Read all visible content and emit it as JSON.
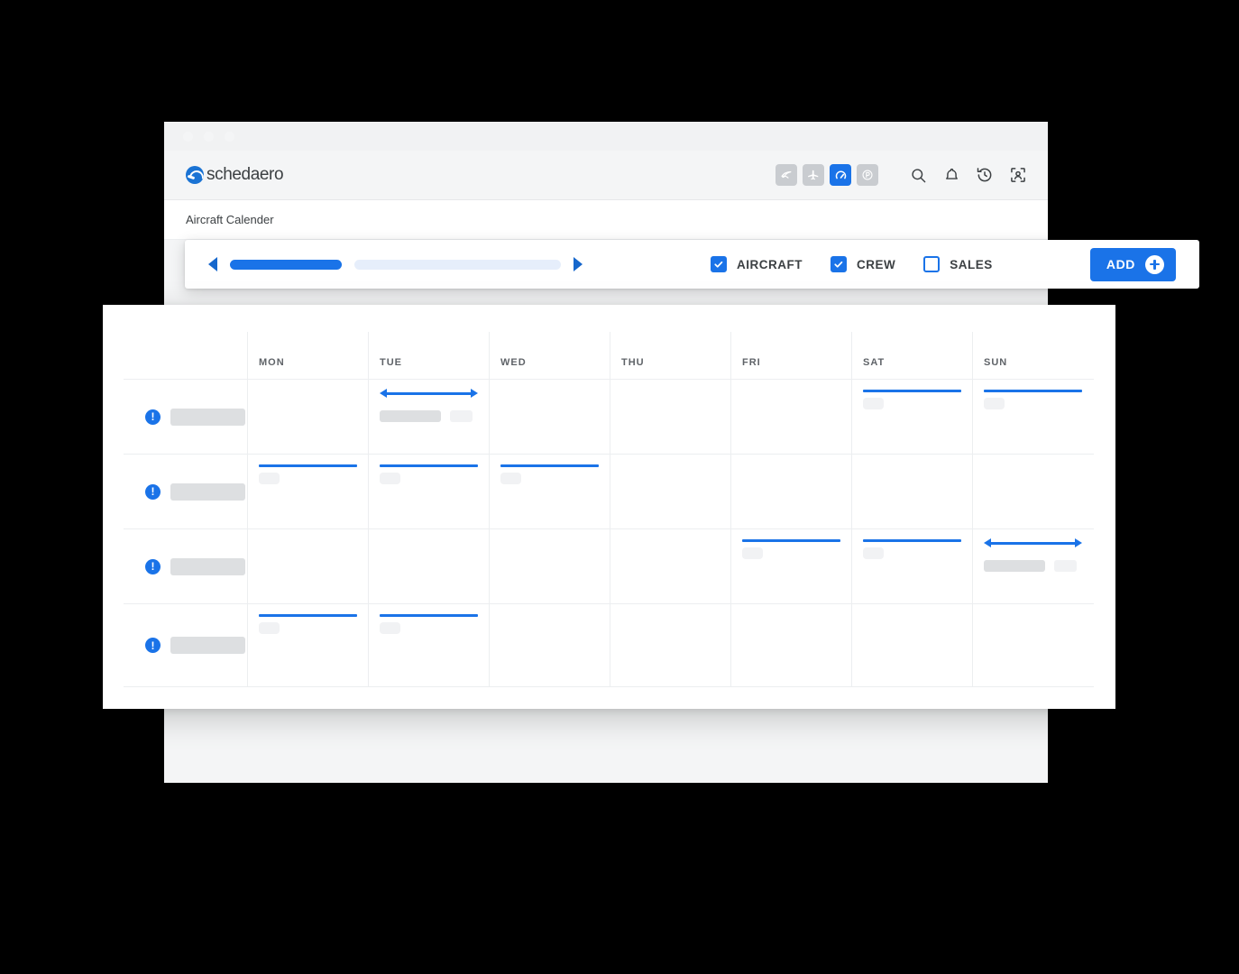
{
  "window": {
    "dots": [
      "close",
      "minimize",
      "maximize"
    ]
  },
  "header": {
    "brand": "schedaero",
    "module_icons": [
      {
        "name": "swoosh-icon",
        "active": false
      },
      {
        "name": "airplane-icon",
        "active": false
      },
      {
        "name": "gauge-icon",
        "active": true
      },
      {
        "name": "parking-icon",
        "active": false
      }
    ],
    "action_icons": [
      {
        "name": "search-icon"
      },
      {
        "name": "bell-icon"
      },
      {
        "name": "history-icon"
      },
      {
        "name": "user-frame-icon"
      }
    ]
  },
  "breadcrumb": {
    "text": "Aircraft Calender"
  },
  "toolbar": {
    "prev_label": "previous",
    "next_label": "next",
    "progress_filled_pct": 35,
    "progress_empty_pct": 65,
    "filters": [
      {
        "label": "AIRCRAFT",
        "checked": true
      },
      {
        "label": "CREW",
        "checked": true
      },
      {
        "label": "SALES",
        "checked": false
      }
    ],
    "add_label": "ADD"
  },
  "calendar": {
    "days": [
      "MON",
      "TUE",
      "WED",
      "THU",
      "FRI",
      "SAT",
      "SUN"
    ],
    "rows": [
      {
        "status": "!",
        "name_placeholder": "",
        "cells": [
          {
            "day": "MON",
            "type": "empty"
          },
          {
            "day": "TUE",
            "type": "arrow",
            "detail": true
          },
          {
            "day": "WED",
            "type": "empty"
          },
          {
            "day": "THU",
            "type": "empty"
          },
          {
            "day": "FRI",
            "type": "empty"
          },
          {
            "day": "SAT",
            "type": "line",
            "detail": false
          },
          {
            "day": "SUN",
            "type": "line",
            "detail": false
          }
        ]
      },
      {
        "status": "!",
        "name_placeholder": "",
        "cells": [
          {
            "day": "MON",
            "type": "line",
            "detail": false
          },
          {
            "day": "TUE",
            "type": "line",
            "detail": false
          },
          {
            "day": "WED",
            "type": "line",
            "detail": false
          },
          {
            "day": "THU",
            "type": "empty"
          },
          {
            "day": "FRI",
            "type": "empty"
          },
          {
            "day": "SAT",
            "type": "empty"
          },
          {
            "day": "SUN",
            "type": "empty"
          }
        ]
      },
      {
        "status": "!",
        "name_placeholder": "",
        "cells": [
          {
            "day": "MON",
            "type": "empty"
          },
          {
            "day": "TUE",
            "type": "empty"
          },
          {
            "day": "WED",
            "type": "empty"
          },
          {
            "day": "THU",
            "type": "empty"
          },
          {
            "day": "FRI",
            "type": "line",
            "detail": false
          },
          {
            "day": "SAT",
            "type": "line",
            "detail": false
          },
          {
            "day": "SUN",
            "type": "arrow",
            "detail": true
          }
        ]
      },
      {
        "status": "!",
        "name_placeholder": "",
        "cells": [
          {
            "day": "MON",
            "type": "line",
            "detail": false
          },
          {
            "day": "TUE",
            "type": "line",
            "detail": false
          },
          {
            "day": "WED",
            "type": "empty"
          },
          {
            "day": "THU",
            "type": "empty"
          },
          {
            "day": "FRI",
            "type": "empty"
          },
          {
            "day": "SAT",
            "type": "empty"
          },
          {
            "day": "SUN",
            "type": "empty"
          }
        ]
      }
    ]
  },
  "colors": {
    "accent": "#1a73e8",
    "accent_dark": "#1667cc",
    "accent_pale": "#e6eefb",
    "text": "#3c4043",
    "muted": "#5f6368",
    "skeleton_dark": "#dddfe1",
    "skeleton_light": "#f1f2f4",
    "chrome": "#f4f5f6",
    "border": "#eceef0",
    "backdrop": "#000000"
  }
}
